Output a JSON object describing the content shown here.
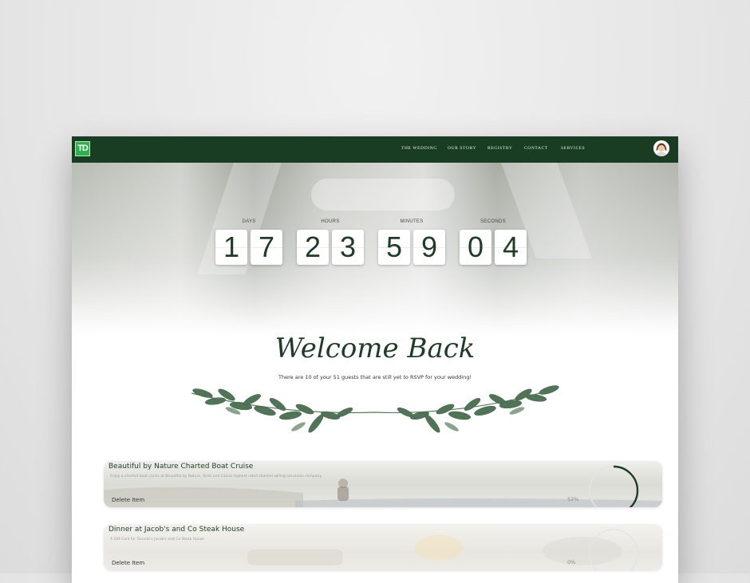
{
  "brand": {
    "logo_text": "TD",
    "colors": {
      "nav": "#193d22",
      "accent": "#1e3d26",
      "logo": "#2cb24a"
    }
  },
  "nav": {
    "items": [
      {
        "label": "THE WEDDING"
      },
      {
        "label": "OUR STORY"
      },
      {
        "label": "REGISTRY"
      },
      {
        "label": "CONTACT"
      },
      {
        "label": "SERVICES"
      }
    ],
    "avatar_icon": "user-avatar-icon"
  },
  "countdown": {
    "groups": [
      {
        "label": "DAYS",
        "digits": [
          "1",
          "7"
        ]
      },
      {
        "label": "HOURS",
        "digits": [
          "2",
          "3"
        ]
      },
      {
        "label": "MINUTES",
        "digits": [
          "5",
          "9"
        ]
      },
      {
        "label": "SECONDS",
        "digits": [
          "0",
          "4"
        ]
      }
    ]
  },
  "welcome": {
    "heading": "Welcome Back",
    "rsvp_text": "There are 10 of your 51 guests that are still yet to RSVP for your wedding!"
  },
  "registry_items": [
    {
      "title": "Beautiful by Nature Charted Boat Cruise",
      "description": "Enjoy a charted boat cruise at Beautiful by Nature, Torks and Caicos highest rated charted sailing excursion company.",
      "delete_label": "Delete Item",
      "progress_label": "52%",
      "progress": 0.52
    },
    {
      "title": "Dinner at Jacob's and Co Steak House",
      "description": "A Gift Card for Toronto's Jacob's and Co Steak House",
      "delete_label": "Delete Item",
      "progress_label": "0%",
      "progress": 0.0
    }
  ]
}
